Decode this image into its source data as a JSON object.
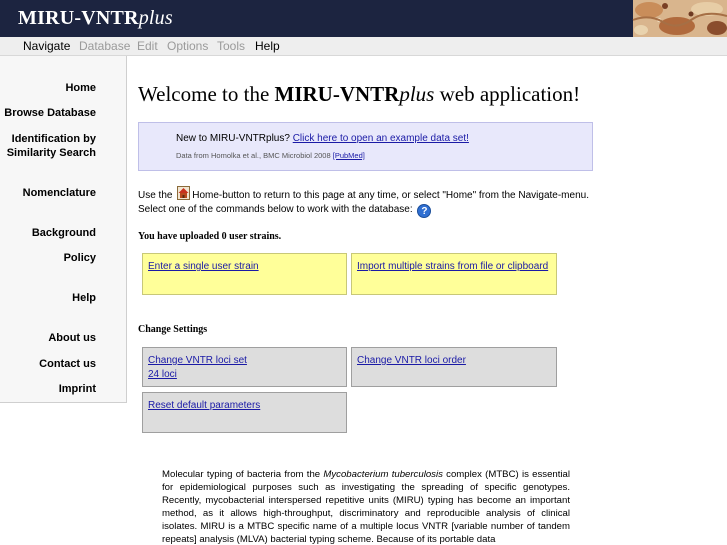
{
  "header": {
    "logo_main": "MIRU-VNTR",
    "logo_italic": "plus"
  },
  "menubar": {
    "items": [
      {
        "label": "Navigate",
        "state": "active"
      },
      {
        "label": "Database",
        "state": "disabled"
      },
      {
        "label": "Edit",
        "state": "disabled"
      },
      {
        "label": "Options",
        "state": "disabled"
      },
      {
        "label": "Tools",
        "state": "disabled"
      },
      {
        "label": "Help",
        "state": "active"
      }
    ]
  },
  "sidebar": {
    "items": [
      {
        "label": "Home"
      },
      {
        "label": "Browse Database"
      },
      {
        "label": "Identification by Similarity Search"
      },
      {
        "label": "Nomenclature"
      },
      {
        "label": "Background"
      },
      {
        "label": "Policy"
      },
      {
        "label": "Help"
      },
      {
        "label": "About us"
      },
      {
        "label": "Contact us"
      },
      {
        "label": "Imprint"
      }
    ]
  },
  "main": {
    "title_prefix": "Welcome to the ",
    "title_bold": "MIRU-VNTR",
    "title_italic": "plus",
    "title_suffix": " web application!",
    "intro": {
      "text": "New to MIRU-VNTRplus?",
      "link": "Click here to open an example data set!",
      "source": "Data from Homolka et al., BMC Microbiol 2008",
      "pubmed": "[PubMed]"
    },
    "home_text_before": "Use the",
    "home_text_after": "Home-button to return to this page at any time, or select \"Home\" from the Navigate-menu.",
    "select_text": "Select one of the commands below to work with the database:",
    "help_icon_glyph": "?",
    "uploaded_heading": "You have uploaded 0 user strains.",
    "upload_actions": [
      {
        "label": "Enter a single user strain"
      },
      {
        "label": "Import multiple strains from file or clipboard"
      }
    ],
    "settings_heading": "Change Settings",
    "settings_actions": [
      {
        "label": "Change VNTR loci set",
        "sub": "24 loci"
      },
      {
        "label": "Change VNTR loci order"
      },
      {
        "label": "Reset default parameters"
      }
    ],
    "description": {
      "part1": "Molecular typing of bacteria from the ",
      "italic": "Mycobacterium tuberculosis",
      "part2": " complex (MTBC) is essential for epidemiological purposes such as investigating the spreading of specific genotypes. Recently, mycobacterial interspersed repetitive units (MIRU) typing has become an important method, as it allows high-throughput, discriminatory and reproducible analysis of clinical isolates. MIRU is a MTBC specific name of a multiple locus VNTR [variable number of tandem repeats] analysis (MLVA) bacterial typing scheme. Because of its portable data"
    }
  },
  "colors": {
    "header_bg": "#1c2440",
    "menubar_bg": "#eeeeee",
    "intro_bg": "#e8e8fb",
    "action_yellow": "#ffff99",
    "action_gray": "#dddddd",
    "link": "#1a1aa6"
  },
  "icons": {
    "home": "home-icon",
    "help": "help-icon",
    "header_art": "microscopy-image"
  }
}
